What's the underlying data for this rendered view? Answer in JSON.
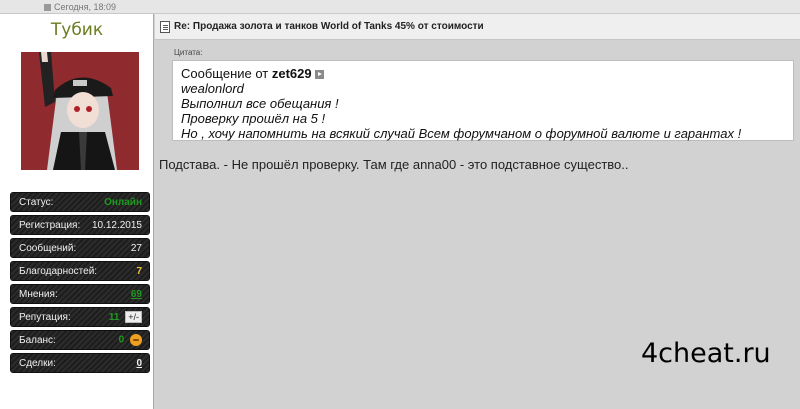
{
  "topbar": {
    "date": "Сегодня, 18:09"
  },
  "user": {
    "name": "Тубик",
    "stats": [
      {
        "label": "Статус:",
        "value": "Онлайн"
      },
      {
        "label": "Регистрация:",
        "value": "10.12.2015"
      },
      {
        "label": "Сообщений:",
        "value": "27"
      },
      {
        "label": "Благодарностей:",
        "value": "7"
      },
      {
        "label": "Мнения:",
        "value": "69"
      },
      {
        "label": "Репутация:",
        "value": "11",
        "button": "+/-"
      },
      {
        "label": "Баланс:",
        "value": "0"
      },
      {
        "label": "Сделки:",
        "value": "0"
      }
    ]
  },
  "post": {
    "title": "Re: Продажа золота и танков World of Tanks 45% от стоимости",
    "quote_label": "Цитата:",
    "quote": {
      "from_prefix": "Сообщение от ",
      "from_user": "zet629",
      "lines": [
        "wealonlord",
        "Выполнил все обещания !",
        "Проверку прошёл на 5 !",
        "Но , хочу напомнить на всякий случай Всем форумчаном о форумной валюте и гарантах !"
      ]
    },
    "message": "Подстава. - Не прошёл проверку. Там где anna00 - это подставное существо.."
  },
  "watermark": "4cheat.ru",
  "colors": {
    "username": "#6a7d1e",
    "online": "#1e9a1e",
    "thanks": "#e6c23a",
    "avatar_bg": "#8f2a2e"
  },
  "icons": {
    "post": "document-icon",
    "quote_link": "view-post-icon",
    "balance": "coin-icon",
    "avatar": "anime-avatar"
  }
}
